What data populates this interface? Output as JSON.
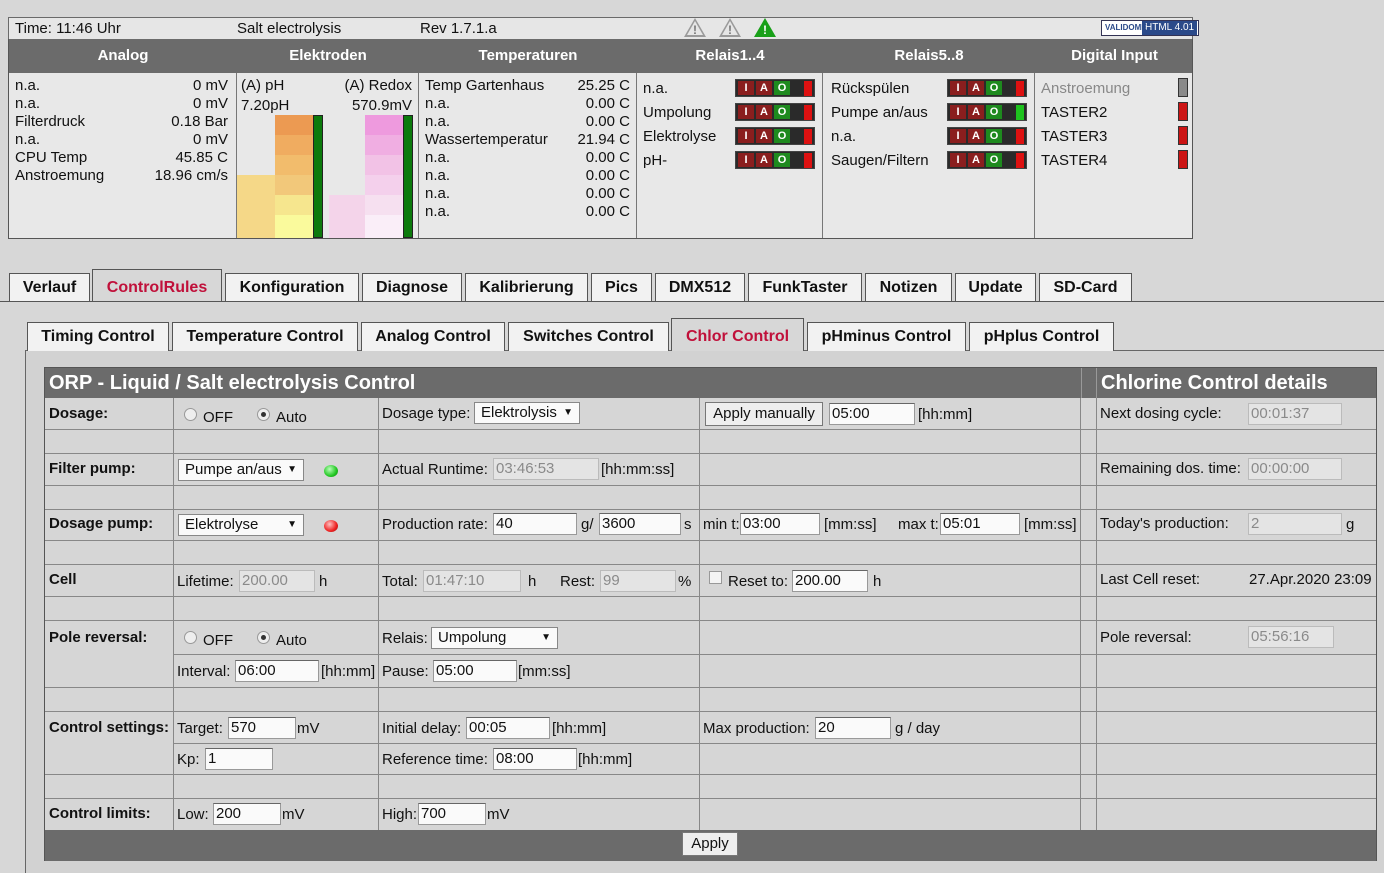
{
  "status": {
    "time": "Time: 11:46 Uhr",
    "app": "Salt electrolysis",
    "rev": "Rev 1.7.1.a",
    "badge": "HTML 4.01",
    "badge_brand": "VALIDOME"
  },
  "panel": {
    "headers": [
      "Analog",
      "Elektroden",
      "Temperaturen",
      "Relais1..4",
      "Relais5..8",
      "Digital Input"
    ],
    "analog": [
      {
        "label": "n.a.",
        "value": "0 mV"
      },
      {
        "label": "n.a.",
        "value": "0 mV"
      },
      {
        "label": "Filterdruck",
        "value": "0.18 Bar"
      },
      {
        "label": "n.a.",
        "value": "0 mV"
      },
      {
        "label": "CPU Temp",
        "value": "45.85 C"
      },
      {
        "label": "Anstroemung",
        "value": "18.96 cm/s"
      }
    ],
    "electrodes": {
      "ph_label": "(A) pH",
      "ph_value": "7.20pH",
      "redox_label": "(A) Redox",
      "redox_value": "570.9mV"
    },
    "temps": [
      {
        "label": "Temp Gartenhaus",
        "value": "25.25 C"
      },
      {
        "label": "n.a.",
        "value": "0.00 C"
      },
      {
        "label": "n.a.",
        "value": "0.00 C"
      },
      {
        "label": "Wassertemperatur",
        "value": "21.94 C"
      },
      {
        "label": "n.a.",
        "value": "0.00 C"
      },
      {
        "label": "n.a.",
        "value": "0.00 C"
      },
      {
        "label": "n.a.",
        "value": "0.00 C"
      },
      {
        "label": "n.a.",
        "value": "0.00 C"
      }
    ],
    "relay_keys": [
      "I",
      "A",
      "O"
    ],
    "relais1": [
      {
        "label": "n.a.",
        "on": false
      },
      {
        "label": "Umpolung",
        "on": false
      },
      {
        "label": "Elektrolyse",
        "on": false
      },
      {
        "label": "pH-",
        "on": false
      }
    ],
    "relais2": [
      {
        "label": "Rückspülen",
        "on": false
      },
      {
        "label": "Pumpe an/aus",
        "on": true
      },
      {
        "label": "n.a.",
        "on": false
      },
      {
        "label": "Saugen/Filtern",
        "on": false
      }
    ],
    "digital": [
      {
        "label": "Anstroemung",
        "state": "off"
      },
      {
        "label": "TASTER2",
        "state": "on"
      },
      {
        "label": "TASTER3",
        "state": "on"
      },
      {
        "label": "TASTER4",
        "state": "on"
      }
    ]
  },
  "tabs": [
    "Verlauf",
    "ControlRules",
    "Konfiguration",
    "Diagnose",
    "Kalibrierung",
    "Pics",
    "DMX512",
    "FunkTaster",
    "Notizen",
    "Update",
    "SD-Card"
  ],
  "subtabs": [
    "Timing Control",
    "Temperature Control",
    "Analog Control",
    "Switches Control",
    "Chlor Control",
    "pHminus Control",
    "pHplus Control"
  ],
  "control": {
    "title": "ORP - Liquid / Salt electrolysis Control",
    "details_title": "Chlorine Control details",
    "dosage": {
      "label": "Dosage:",
      "off": "OFF",
      "auto": "Auto",
      "type_label": "Dosage type:",
      "type_value": "Elektrolysis",
      "apply_manually": "Apply manually",
      "manual_time": "05:00",
      "manual_unit": "[hh:mm]",
      "next_label": "Next dosing cycle:",
      "next_value": "00:01:37"
    },
    "filter": {
      "label": "Filter pump:",
      "pump": "Pumpe an/aus",
      "runtime_label": "Actual Runtime:",
      "runtime_value": "03:46:53",
      "runtime_unit": "[hh:mm:ss]",
      "remaining_label": "Remaining dos. time:",
      "remaining_value": "00:00:00"
    },
    "dpump": {
      "label": "Dosage pump:",
      "pump": "Elektrolyse",
      "prod_label": "Production rate:",
      "prod_value": "40",
      "prod_unit": "g/",
      "prod_secs": "3600",
      "prod_secs_unit": "s",
      "min_label": "min t:",
      "min_value": "03:00",
      "min_unit": "[mm:ss]",
      "max_label": "max t:",
      "max_value": "05:01",
      "max_unit": "[mm:ss]",
      "today_label": "Today's production:",
      "today_value": "2",
      "today_unit": "g"
    },
    "cell": {
      "label": "Cell",
      "lifetime_label": "Lifetime:",
      "lifetime_value": "200.00",
      "lifetime_unit": "h",
      "total_label": "Total:",
      "total_value": "01:47:10",
      "total_unit": "h",
      "rest_label": "Rest:",
      "rest_value": "99",
      "rest_unit": "%",
      "reset_label": "Reset to:",
      "reset_value": "200.00",
      "reset_unit": "h",
      "last_label": "Last Cell reset:",
      "last_value": "27.Apr.2020 23:09"
    },
    "pole": {
      "label": "Pole reversal:",
      "off": "OFF",
      "auto": "Auto",
      "relais_label": "Relais:",
      "relais_value": "Umpolung",
      "interval_label": "Interval:",
      "interval_value": "06:00",
      "interval_unit": "[hh:mm]",
      "pause_label": "Pause:",
      "pause_value": "05:00",
      "pause_unit": "[mm:ss]",
      "detail_label": "Pole reversal:",
      "detail_value": "05:56:16"
    },
    "settings": {
      "label": "Control settings:",
      "target_label": "Target:",
      "target_value": "570",
      "target_unit": "mV",
      "delay_label": "Initial delay:",
      "delay_value": "00:05",
      "delay_unit": "[hh:mm]",
      "maxprod_label": "Max production:",
      "maxprod_value": "20",
      "maxprod_unit": "g / day",
      "kp_label": "Kp:",
      "kp_value": "1",
      "ref_label": "Reference time:",
      "ref_value": "08:00",
      "ref_unit": "[hh:mm]"
    },
    "limits": {
      "label": "Control limits:",
      "low_label": "Low:",
      "low_value": "200",
      "low_unit": "mV",
      "high_label": "High:",
      "high_value": "700",
      "high_unit": "mV"
    },
    "apply": "Apply"
  }
}
